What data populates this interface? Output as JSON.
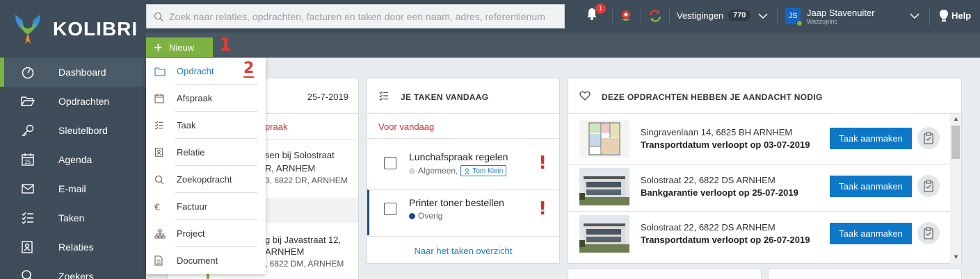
{
  "brand": {
    "name": "KOLIBRI"
  },
  "sidebar": {
    "items": [
      {
        "label": "Dashboard",
        "icon": "dashboard-icon",
        "active": true
      },
      {
        "label": "Opdrachten",
        "icon": "folder-open-icon"
      },
      {
        "label": "Sleutelbord",
        "icon": "key-icon"
      },
      {
        "label": "Agenda",
        "icon": "calendar-icon"
      },
      {
        "label": "E-mail",
        "icon": "envelope-icon"
      },
      {
        "label": "Taken",
        "icon": "tasks-icon"
      },
      {
        "label": "Relaties",
        "icon": "contact-icon"
      },
      {
        "label": "Zoekers",
        "icon": "search-icon"
      }
    ]
  },
  "topbar": {
    "search_placeholder": "Zoek naar relaties, opdrachten, facturen en taken door een naam, adres, referentienum",
    "notification_count": "1",
    "vestigingen_label": "Vestigingen",
    "vestigingen_count": "770",
    "user_initials": "JS",
    "user_name": "Jaap Stavenuiter",
    "user_org": "WazzupInc",
    "help_label": "Help"
  },
  "new_button": {
    "label": "Nieuw"
  },
  "annotations": {
    "step1": "1",
    "step2": "2"
  },
  "dropdown": {
    "items": [
      {
        "label": "Opdracht",
        "icon": "folder-icon"
      },
      {
        "label": "Afspraak",
        "icon": "calendar-icon"
      },
      {
        "label": "Taak",
        "icon": "tasks-icon"
      },
      {
        "label": "Relatie",
        "icon": "contact-icon"
      },
      {
        "label": "Zoekopdracht",
        "icon": "search-icon"
      },
      {
        "label": "Factuur",
        "icon": "euro-icon"
      },
      {
        "label": "Project",
        "icon": "hierarchy-icon"
      },
      {
        "label": "Document",
        "icon": "document-icon"
      }
    ]
  },
  "appointments": {
    "date": "25-7-2019",
    "partial_heading": "praak",
    "items": [
      {
        "line1": "sen bij Solostraat",
        "line2": "R, ARNHEM",
        "line3": "3, 6822 DR, ARNHEM"
      },
      {
        "line1": "g bij Javastraat 12,",
        "line2": "ARNHEM",
        "line3": ", 6822 DM, ARNHEM"
      }
    ]
  },
  "tasks": {
    "title": "JE TAKEN VANDAAG",
    "section": "Voor vandaag",
    "items": [
      {
        "title": "Lunchafspraak regelen",
        "category": "Algemeen,",
        "tag": "Tom Klein",
        "dot_color": "#d9d9d9",
        "priority": "!"
      },
      {
        "title": "Printer toner bestellen",
        "category": "Overig",
        "dot_color": "#1e4a8a",
        "priority": "!"
      }
    ],
    "link": "Naar het taken overzicht"
  },
  "attention": {
    "title": "DEZE OPDRACHTEN HEBBEN JE AANDACHT NODIG",
    "button_label": "Taak aanmaken",
    "items": [
      {
        "address": "Singravenlaan 14, 6825 BH ARNHEM",
        "warning": "Transportdatum verloopt op 03-07-2019",
        "thumb": "floorplan"
      },
      {
        "address": "Solostraat 22, 6822 DS ARNHEM",
        "warning": "Bankgarantie verloopt op 25-07-2019",
        "thumb": "building"
      },
      {
        "address": "Solostraat 22, 6822 DS ARNHEM",
        "warning": "Transportdatum verloopt op 26-07-2019",
        "thumb": "building"
      }
    ]
  },
  "colors": {
    "sidebar": "#3e4d59",
    "accent_green": "#7cb342",
    "primary_blue": "#0e78c8",
    "alert_red": "#d32f2f"
  }
}
